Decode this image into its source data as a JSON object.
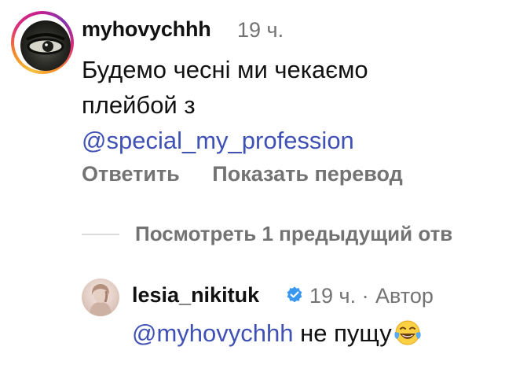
{
  "comment": {
    "username": "myhovychhh",
    "time": "19 ч.",
    "text_line1": "Будемо чесні ми чекаємо",
    "text_line2": "плейбой з",
    "mention": "@special_my_profession",
    "reply_label": "Ответить",
    "translate_label": "Показать перевод"
  },
  "view_previous": {
    "label": "Посмотреть 1 предыдущий отв"
  },
  "reply": {
    "username": "lesia_nikituk",
    "verified": true,
    "time": "19 ч.",
    "separator": "·",
    "author_label": "Автор",
    "mention": "@myhovychhh",
    "text": " не пущу",
    "emoji": "face-with-tears-of-joy"
  },
  "colors": {
    "mention": "#3f51b5",
    "secondary_text": "#737373",
    "verified_badge": "#3897f0",
    "divider": "#dbdbdb"
  }
}
